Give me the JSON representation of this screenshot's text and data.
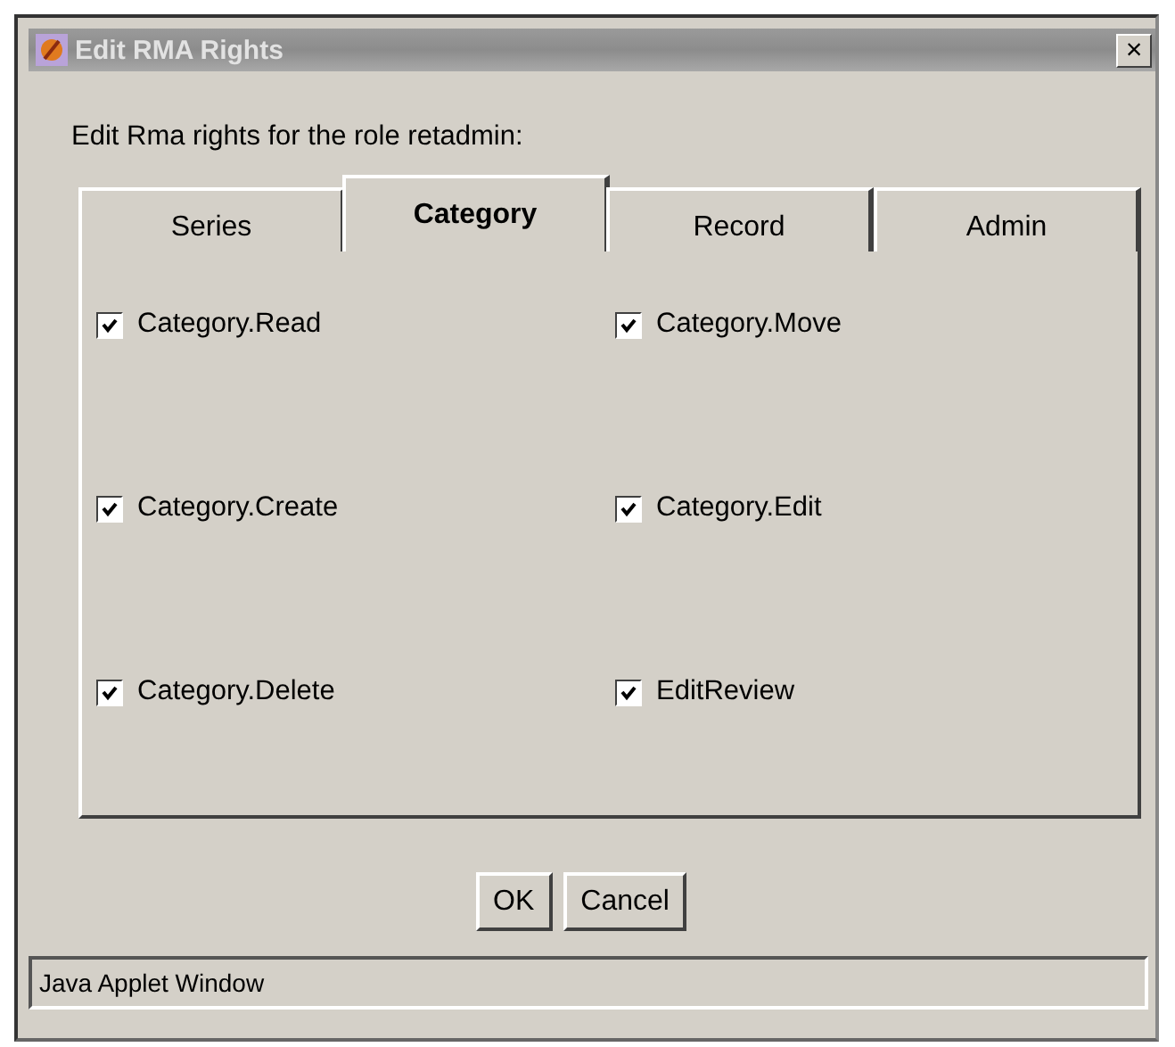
{
  "window": {
    "title": "Edit RMA Rights",
    "close": "×"
  },
  "prompt": "Edit Rma rights for the role retadmin:",
  "tabs": [
    {
      "label": "Series",
      "selected": false
    },
    {
      "label": "Category",
      "selected": true
    },
    {
      "label": "Record",
      "selected": false
    },
    {
      "label": "Admin",
      "selected": false
    }
  ],
  "rights": [
    {
      "label": "Category.Read",
      "checked": true
    },
    {
      "label": "Category.Move",
      "checked": true
    },
    {
      "label": "Category.Create",
      "checked": true
    },
    {
      "label": "Category.Edit",
      "checked": true
    },
    {
      "label": "Category.Delete",
      "checked": true
    },
    {
      "label": "EditReview",
      "checked": true
    }
  ],
  "buttons": [
    "OK",
    "Cancel"
  ],
  "status_bar": "Java Applet Window"
}
